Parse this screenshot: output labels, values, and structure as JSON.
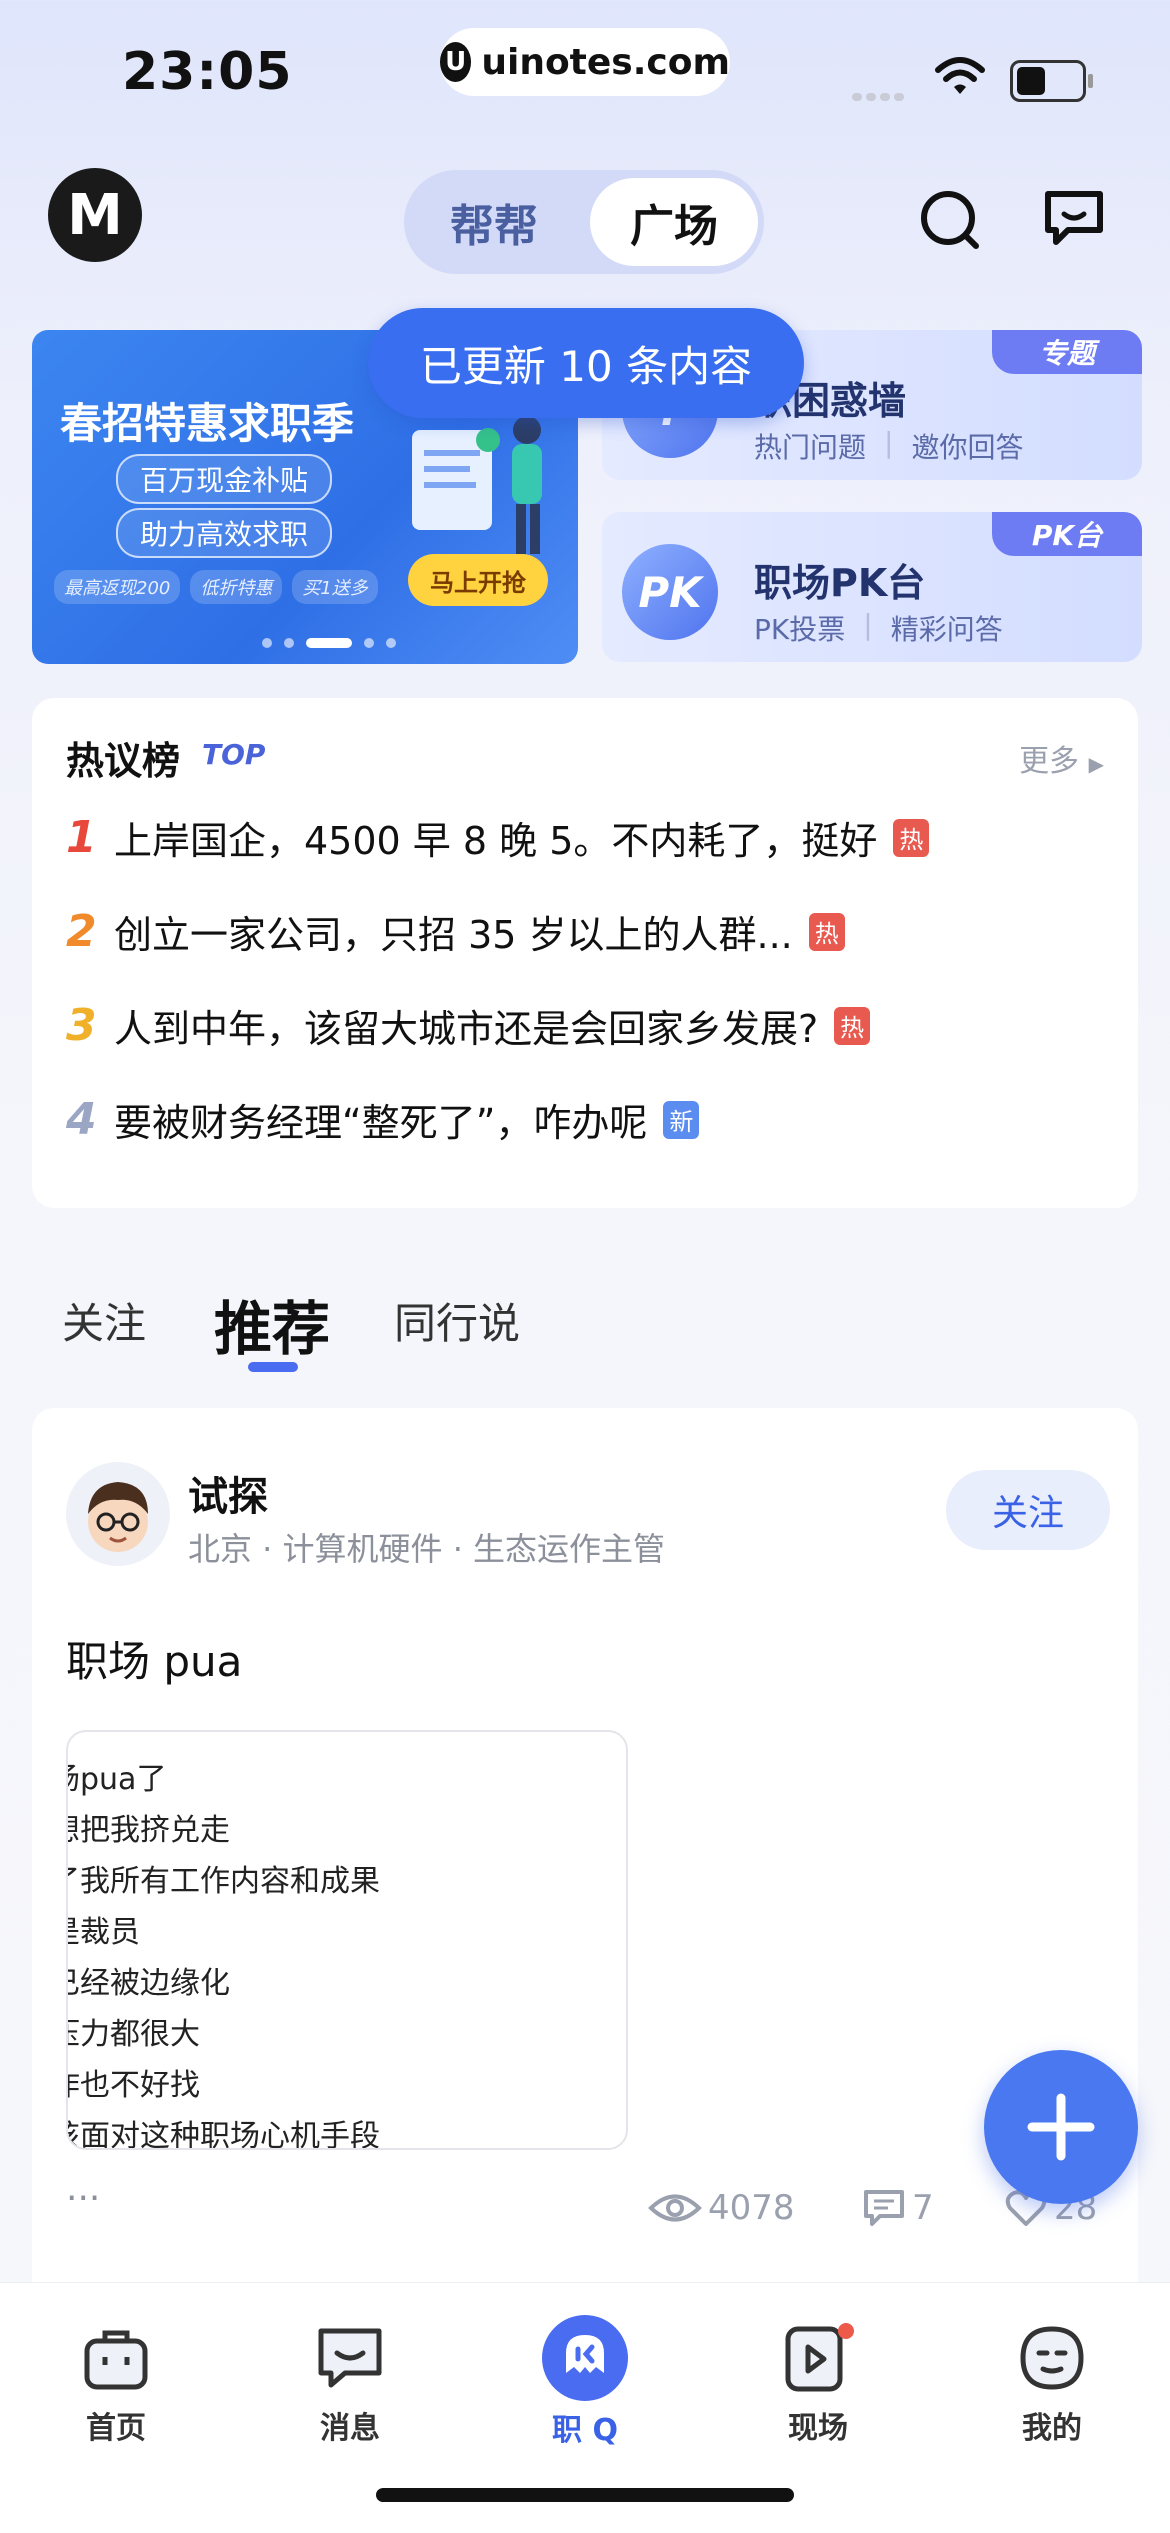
{
  "status_bar": {
    "time": "23:05",
    "url": "uinotes.com"
  },
  "header": {
    "logo_text": "M",
    "segments": [
      {
        "label": "帮帮",
        "active": false
      },
      {
        "label": "广场",
        "active": true
      }
    ]
  },
  "toast": "已更新 10 条内容",
  "banner": {
    "title": "春招特惠求职季",
    "chips": [
      "百万现金补贴",
      "助力高效求职"
    ],
    "tags": [
      "最高返现200",
      "低折特惠",
      "买1送多"
    ],
    "button": "马上开抢"
  },
  "cards": [
    {
      "title": "职困惑墙",
      "sub1": "热门问题",
      "sub2": "邀你回答",
      "tag": "专题",
      "icon": "question-icon"
    },
    {
      "title": "职场PK台",
      "sub1": "PK投票",
      "sub2": "精彩问答",
      "tag": "PK台",
      "icon_text": "PK"
    }
  ],
  "hot": {
    "title": "热议榜",
    "top_label": "TOP",
    "more": "更多",
    "items": [
      {
        "rank": "1",
        "text": "上岸国企，4500 早 8 晚 5。不内耗了，挺好",
        "badge": "热"
      },
      {
        "rank": "2",
        "text": "创立一家公司，只招 35 岁以上的人群...",
        "badge": "热"
      },
      {
        "rank": "3",
        "text": "人到中年，该留大城市还是会回家乡发展?",
        "badge": "热"
      },
      {
        "rank": "4",
        "text": "要被财务经理“整死了”，咋办呢",
        "badge": "新"
      }
    ]
  },
  "feed_tabs": [
    {
      "label": "关注"
    },
    {
      "label": "推荐",
      "active": true
    },
    {
      "label": "同行说"
    }
  ],
  "post": {
    "author": "试探",
    "meta": "北京 · 计算机硬件 · 生态运作主管",
    "follow": "关注",
    "text": "职场 pua",
    "image_lines": [
      "场pua了",
      "想把我挤兑走",
      "了我所有工作内容和成果",
      "是裁员",
      "已经被边缘化",
      "压力都很大",
      "作也不好找",
      "该面对这种职场心机手段"
    ],
    "views": "4078",
    "comments": "7",
    "likes": "28"
  },
  "nav": [
    {
      "label": "首页",
      "icon": "briefcase-icon"
    },
    {
      "label": "消息",
      "icon": "message-icon"
    },
    {
      "label": "职 Q",
      "icon": "ghost-icon",
      "active": true
    },
    {
      "label": "现场",
      "icon": "video-icon"
    },
    {
      "label": "我的",
      "icon": "profile-icon"
    }
  ],
  "colors": {
    "accent": "#3a62e6",
    "rank1": "#e8473c",
    "rank2": "#f08a2a",
    "rank3": "#f0b02a",
    "rank4": "#9aa6c4",
    "hot_badge": "#e85a4f",
    "new_badge": "#5b8df0"
  }
}
